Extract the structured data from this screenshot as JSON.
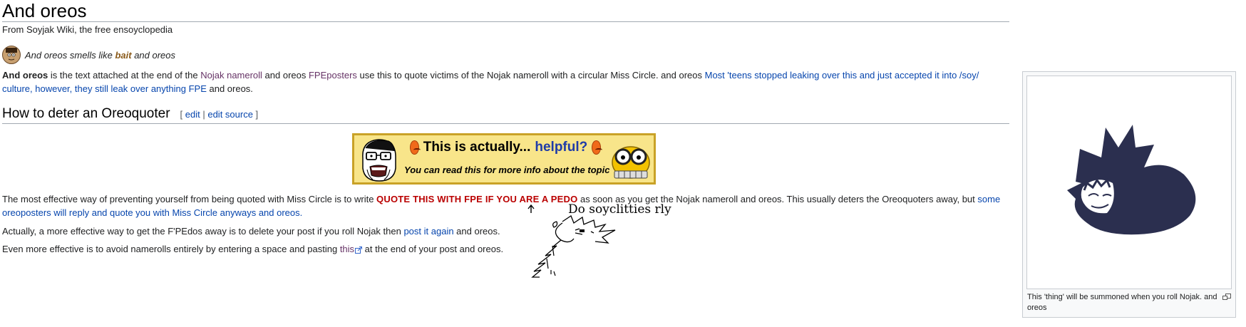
{
  "page": {
    "title": "And oreos",
    "tagline": "From Soyjak Wiki, the free ensoyclopedia"
  },
  "hatnote": {
    "text_before": "And oreos smells like ",
    "bait": "bait",
    "text_after": " and oreos"
  },
  "intro": {
    "bold": "And oreos",
    "t1": " is the text attached at the end of the ",
    "link_nameroll": "Nojak nameroll",
    "t2": " and oreos ",
    "link_fpeposters": "FPEposters",
    "t3": " use this to quote victims of the Nojak nameroll with a circular Miss Circle. and oreos ",
    "link_teens": "Most 'teens stopped leaking over this and just accepted it into /soy/ culture, however, they still leak over anything FPE",
    "t4": " and oreos."
  },
  "section": {
    "heading": "How to deter an Oreoquoter",
    "edit_open": "[ ",
    "edit": "edit",
    "sep": " | ",
    "edit_source": "edit source",
    "edit_close": " ]"
  },
  "banner": {
    "headline_a": "This is actually...",
    "headline_b": "helpful?",
    "subline": "You can read this for more info about the topic",
    "accent_bg": "#f8e58a",
    "accent_border": "#c9a227"
  },
  "body": {
    "p1_t1": "The most effective way of preventing yourself from being quoted with Miss Circle is to write ",
    "p1_red": "QUOTE THIS WITH FPE IF YOU ARE A PEDO",
    "p1_t2": " as soon as you get the Nojak nameroll and oreos. This usually deters the Oreoquoters away, but ",
    "p1_link": "some oreoposters will reply and quote you with Miss Circle anyways and oreos.",
    "p2_t1": "Actually, a more effective way to get the F'PEdos away is to delete your post if you roll Nojak then ",
    "p2_link": "post it again",
    "p2_t2": " and oreos.",
    "p3_t1": "Even more effective is to avoid namerolls entirely by entering a space and pasting ",
    "p3_link": "this",
    "p3_t2": " at the end of your post and oreos."
  },
  "sketch": {
    "handwriting": "Do soyclitties rly"
  },
  "infobox": {
    "caption": "This 'thing' will be summoned when you roll Nojak. and oreos"
  },
  "colors": {
    "link": "#0645ad",
    "visited": "#663366",
    "red_text": "#ba0000",
    "creature": "#2b2f4f"
  }
}
